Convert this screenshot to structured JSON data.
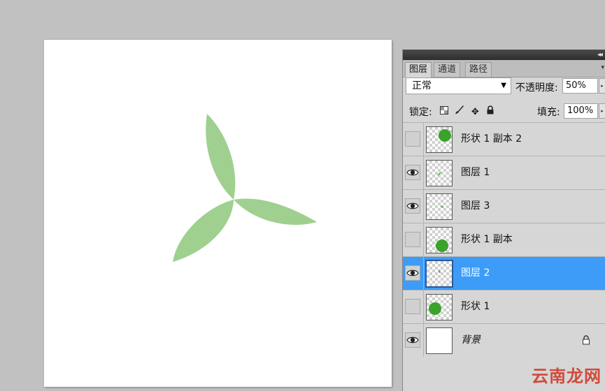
{
  "panel": {
    "tabs": [
      {
        "label": "图层",
        "active": true
      },
      {
        "label": "通道",
        "active": false
      },
      {
        "label": "路径",
        "active": false
      }
    ],
    "blend_mode": "正常",
    "opacity_label": "不透明度:",
    "opacity_value": "50%",
    "lock_label": "锁定:",
    "fill_label": "填充:",
    "fill_value": "100%",
    "layers": [
      {
        "name": "形状 1 副本 2",
        "visible": false,
        "selected": false,
        "thumb": "circle-top-right"
      },
      {
        "name": "图层 1",
        "visible": true,
        "selected": false,
        "thumb": "tiny-mark"
      },
      {
        "name": "图层 3",
        "visible": true,
        "selected": false,
        "thumb": "tiny-mark"
      },
      {
        "name": "形状 1 副本",
        "visible": false,
        "selected": false,
        "thumb": "circle-bottom-right"
      },
      {
        "name": "图层 2",
        "visible": true,
        "selected": true,
        "thumb": "tiny-mark"
      },
      {
        "name": "形状 1",
        "visible": false,
        "selected": false,
        "thumb": "circle-left"
      },
      {
        "name": "背景",
        "visible": true,
        "selected": false,
        "thumb": "white",
        "locked": true
      }
    ]
  },
  "watermark": "云南龙网",
  "colors": {
    "petal": "#9fd08f",
    "shape_green": "#3aa32a",
    "selection": "#3c9cf7",
    "watermark": "#d04a3a"
  }
}
